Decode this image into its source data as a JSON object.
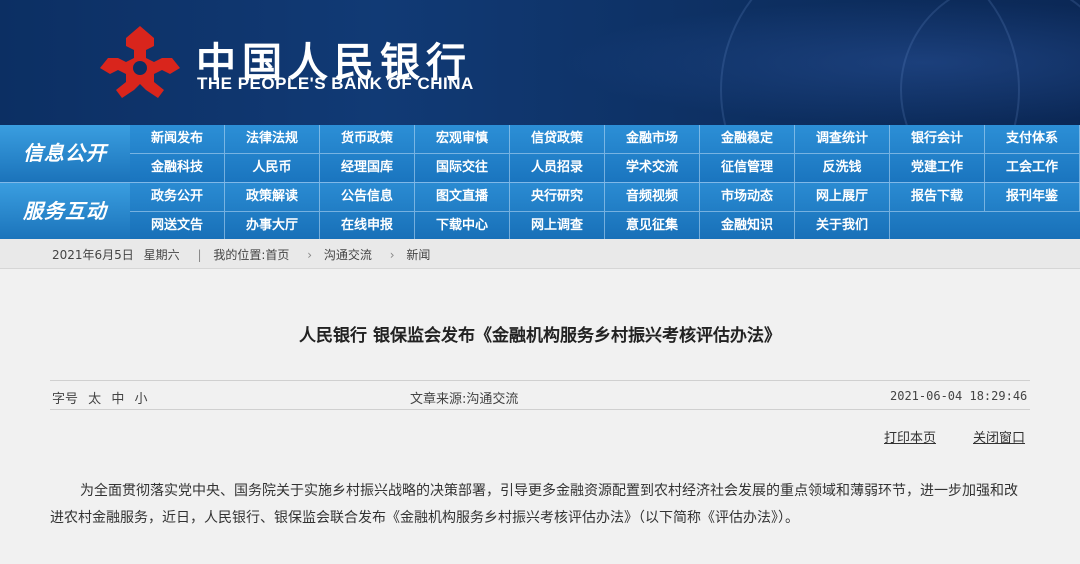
{
  "header": {
    "name_cn": "中国人民银行",
    "name_en": "THE PEOPLE'S BANK OF CHINA"
  },
  "colors": {
    "header_bg": "#113a75",
    "nav_bg": "#1a76bd",
    "logo_red": "#d9251c"
  },
  "nav": {
    "section1_title": "信息公开",
    "section1_items": [
      [
        "新闻发布",
        "法律法规",
        "货币政策",
        "宏观审慎",
        "信贷政策",
        "金融市场",
        "金融稳定",
        "调查统计",
        "银行会计",
        "支付体系"
      ],
      [
        "金融科技",
        "人民币",
        "经理国库",
        "国际交往",
        "人员招录",
        "学术交流",
        "征信管理",
        "反洗钱",
        "党建工作",
        "工会工作"
      ]
    ],
    "section2_title": "服务互动",
    "section2_items": [
      [
        "政务公开",
        "政策解读",
        "公告信息",
        "图文直播",
        "央行研究",
        "音频视频",
        "市场动态",
        "网上展厅",
        "报告下载",
        "报刊年鉴"
      ],
      [
        "网送文告",
        "办事大厅",
        "在线申报",
        "下载中心",
        "网上调查",
        "意见征集",
        "金融知识",
        "关于我们"
      ]
    ]
  },
  "breadcrumb": {
    "date": "2021年6月5日",
    "weekday": "星期六",
    "location_label": "我的位置:",
    "items": [
      "首页",
      "沟通交流",
      "新闻"
    ]
  },
  "article": {
    "title": "人民银行 银保监会发布《金融机构服务乡村振兴考核评估办法》",
    "font_size_label": "字号",
    "font_sizes": [
      "太",
      "中",
      "小"
    ],
    "source_label": "文章来源:",
    "source": "沟通交流",
    "datetime": "2021-06-04 18:29:46",
    "print_label": "打印本页",
    "close_label": "关闭窗口",
    "paragraph": "为全面贯彻落实党中央、国务院关于实施乡村振兴战略的决策部署，引导更多金融资源配置到农村经济社会发展的重点领域和薄弱环节，进一步加强和改进农村金融服务，近日，人民银行、银保监会联合发布《金融机构服务乡村振兴考核评估办法》（以下简称《评估办法》）。"
  }
}
